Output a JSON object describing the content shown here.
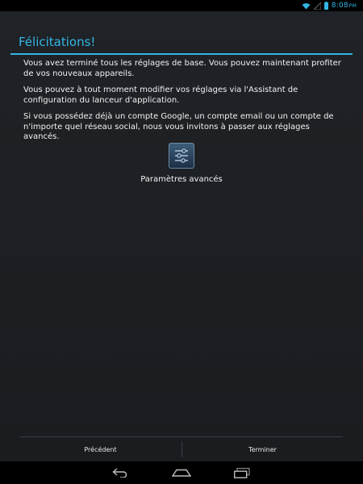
{
  "status_bar": {
    "time": "8:08",
    "ampm": "PM"
  },
  "title": "Félicitations!",
  "paragraphs": [
    "Vous avez terminé tous les réglages de base. Vous pouvez maintenant profiter de vos nouveaux appareils.",
    "Vous pouvez à tout moment modifier vos réglages via l'Assistant de configuration du lanceur d'application.",
    "Si vous possédez déjà un compte Google, un compte email ou un compte de n'importe quel réseau social, nous vous invitons à passer aux réglages avancés."
  ],
  "advanced": {
    "label": "Paramètres avancés",
    "icon": "settings-sliders-icon"
  },
  "buttons": {
    "previous": "Précédent",
    "finish": "Terminer"
  },
  "colors": {
    "accent": "#33b5e5",
    "background": "#1f2226"
  }
}
